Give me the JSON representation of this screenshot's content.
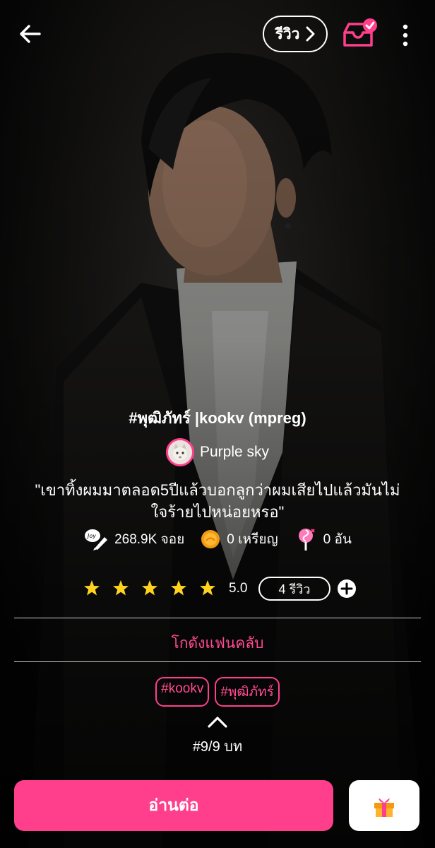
{
  "header": {
    "review_label": "รีวิว",
    "icons": [
      "back-arrow-icon",
      "chevron-right-icon",
      "shelf-added-icon",
      "more-vertical-icon"
    ]
  },
  "story": {
    "title": "#พุฒิภัทร์ |kookv (mpreg)",
    "author": "Purple sky",
    "quote": "\"เขาทิ้งผมมาตลอด5ปีแล้วบอกลูกว่าผมเสียไปแล้วมันไม่ใจร้ายไปหน่อยหรอ\"",
    "stats": {
      "joy": "268.9K จอย",
      "coins": "0 เหรียญ",
      "candies": "0 อัน"
    },
    "rating": "5.0",
    "stars": 5,
    "review_count": "4 รีวิว",
    "fanclub": "โกดังแฟนคลับ",
    "tags": [
      "#kookv",
      "#พุฒิภัทร์"
    ],
    "chapter": "#9/9 บท"
  },
  "actions": {
    "read": "อ่านต่อ"
  },
  "colors": {
    "accent": "#ff3f8c",
    "star": "#ffd21f",
    "background": "#000000"
  }
}
